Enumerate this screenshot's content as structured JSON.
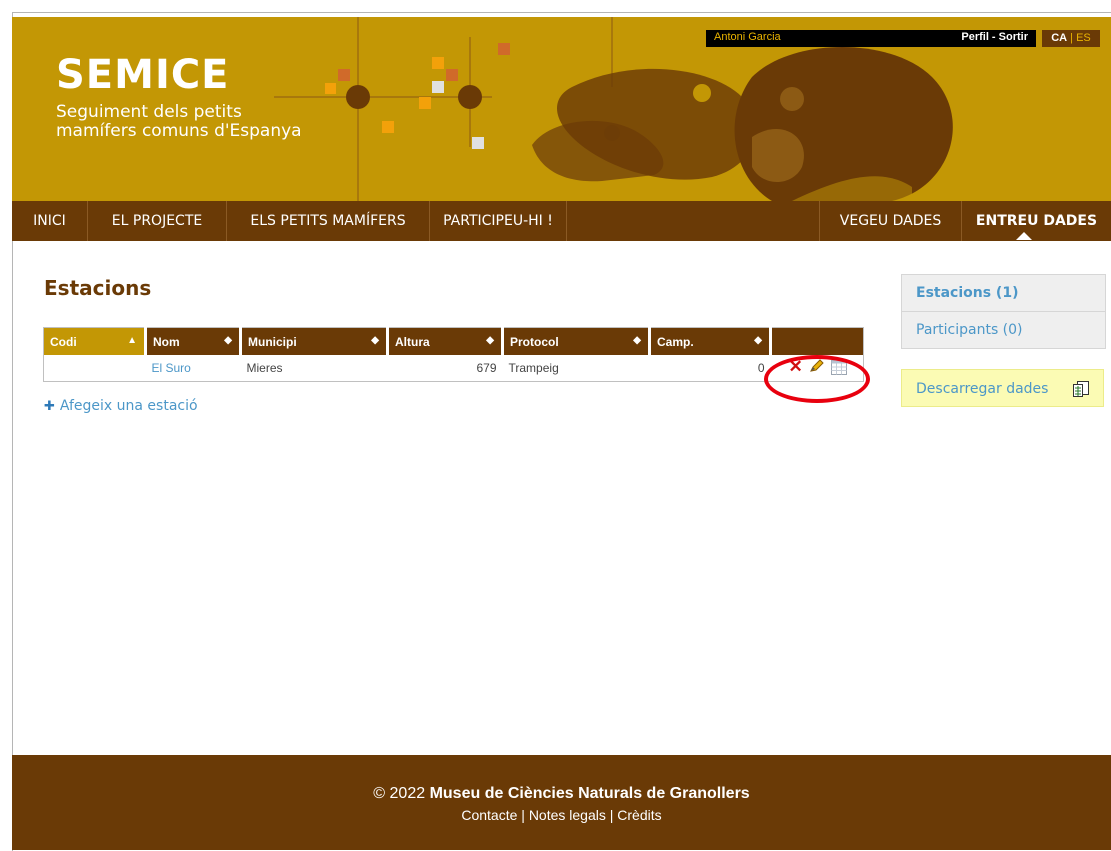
{
  "header": {
    "title": "SEMICE",
    "subtitle": "Seguiment dels petits mamífers comuns d'Espanya",
    "user_name": "Antoni Garcia",
    "profile_link": "Perfil",
    "links_sep": " - ",
    "logout_link": "Sortir",
    "lang_active": "CA",
    "lang_sep": " | ",
    "lang_other": "ES"
  },
  "nav": {
    "items": [
      {
        "label": "INICI"
      },
      {
        "label": "EL PROJECTE"
      },
      {
        "label": "ELS PETITS MAMÍFERS"
      },
      {
        "label": "PARTICIPEU-HI !"
      },
      {
        "label": "VEGEU DADES"
      },
      {
        "label": "ENTREU DADES"
      }
    ]
  },
  "main": {
    "title": "Estacions",
    "table": {
      "columns": [
        "Codi",
        "Nom",
        "Municipi",
        "Altura",
        "Protocol",
        "Camp."
      ],
      "rows": [
        {
          "codi": "",
          "nom": "El Suro",
          "municipi": "Mieres",
          "altura": "679",
          "protocol": "Trampeig",
          "camp": "0"
        }
      ]
    },
    "add_link": "Afegeix una estació"
  },
  "sidebar": {
    "items": [
      {
        "label": "Estacions (1)"
      },
      {
        "label": "Participants (0)"
      }
    ],
    "download": "Descarregar dades"
  },
  "footer": {
    "copyright": "© 2022",
    "org": "Museu de Ciències Naturals de Granollers",
    "links": [
      "Contacte",
      "Notes legals",
      "Crèdits"
    ],
    "sep": " | "
  },
  "colors": {
    "header_gold": "#c39705",
    "brown": "#6a3a06",
    "link_blue": "#4c97c8",
    "highlight_red": "#e8000e"
  }
}
